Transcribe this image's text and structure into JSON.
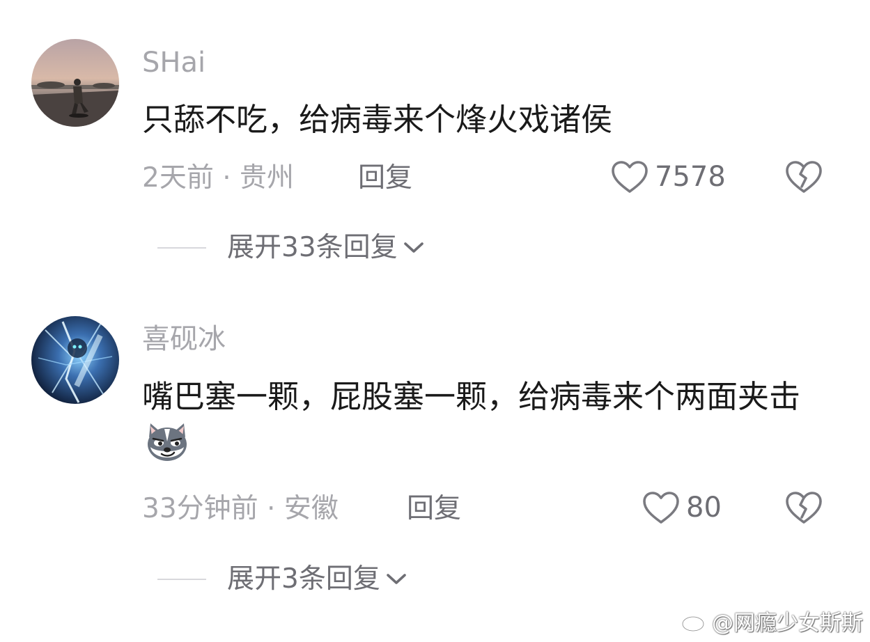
{
  "comments": [
    {
      "username": "SHai",
      "text": "只舔不吃，给病毒来个烽火戏诸侯",
      "time_location": "2天前 · 贵州",
      "reply_label": "回复",
      "likes": "7578",
      "expand_label": "展开33条回复"
    },
    {
      "username": "喜砚冰",
      "text": "嘴巴塞一颗，屁股塞一颗，给病毒来个两面夹击",
      "emoji": "husky-smirk-emoji",
      "time_location": "33分钟前 · 安徽",
      "reply_label": "回复",
      "likes": "80",
      "expand_label": "展开3条回复"
    }
  ],
  "icons": {
    "like": "heart-outline-icon",
    "dislike": "broken-heart-icon",
    "expand": "chevron-down-icon",
    "watermark": "weibo-logo-icon"
  },
  "watermark": "@网瘾少女斯斯",
  "colors": {
    "text": "#1a1a1a",
    "secondary": "#a6a6ab",
    "action": "#6e6e74",
    "background": "#ffffff"
  }
}
